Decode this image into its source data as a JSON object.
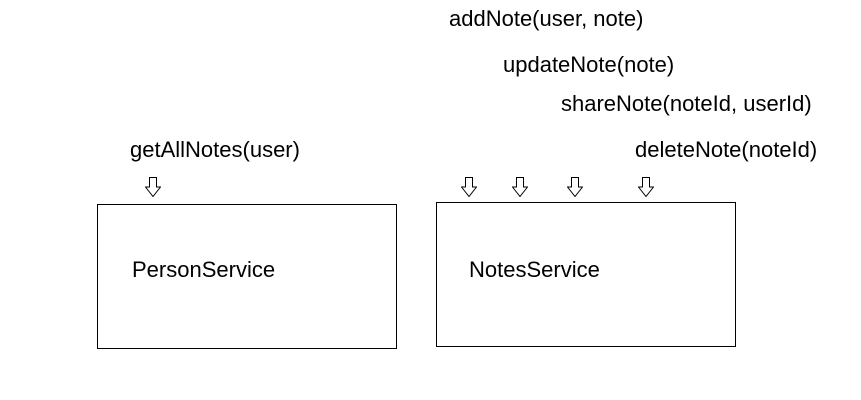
{
  "diagram": {
    "person_service": {
      "title": "PersonService",
      "methods": [
        "getAllNotes(user)"
      ]
    },
    "notes_service": {
      "title": "NotesService",
      "methods": [
        "addNote(user, note)",
        "updateNote(note)",
        "shareNote(noteId, userId)",
        "deleteNote(noteId)"
      ]
    },
    "colors": {
      "stroke": "#000000",
      "background": "#ffffff"
    },
    "icons": {
      "method_arrow": "hollow-down-arrow-icon"
    }
  }
}
